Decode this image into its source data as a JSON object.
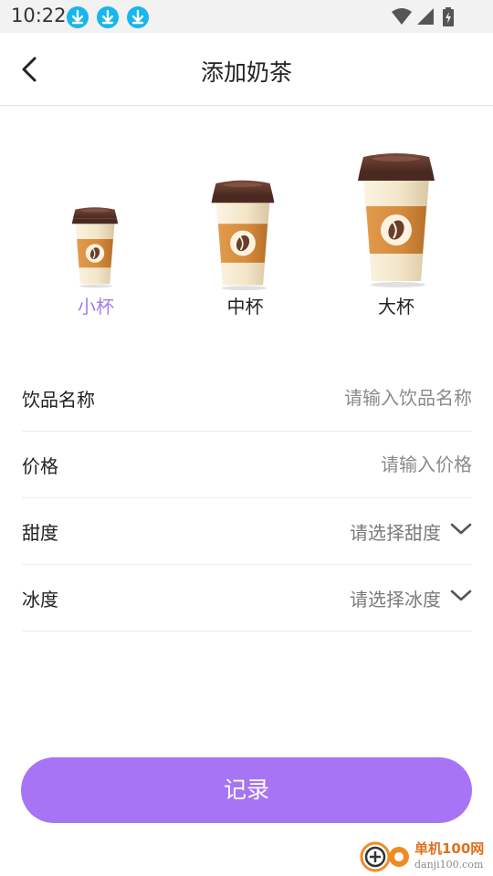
{
  "status_bar": {
    "time": "10:22",
    "notification_icons": [
      "download-icon",
      "download-icon",
      "download-icon"
    ],
    "system_icons": [
      "wifi-icon",
      "signal-icon",
      "battery-charging-icon"
    ]
  },
  "header": {
    "title": "添加奶茶",
    "back_icon": "chevron-left-icon"
  },
  "cup_sizes": {
    "selected": "小杯",
    "options": [
      {
        "label": "小杯",
        "icon": "small-cup-icon"
      },
      {
        "label": "中杯",
        "icon": "medium-cup-icon"
      },
      {
        "label": "大杯",
        "icon": "large-cup-icon"
      }
    ]
  },
  "form": {
    "name": {
      "label": "饮品名称",
      "value": "",
      "placeholder": "请输入饮品名称"
    },
    "price": {
      "label": "价格",
      "value": "",
      "placeholder": "请输入价格"
    },
    "sweetness": {
      "label": "甜度",
      "value": "请选择甜度",
      "icon": "chevron-down-icon"
    },
    "ice": {
      "label": "冰度",
      "value": "请选择冰度",
      "icon": "chevron-down-icon"
    }
  },
  "submit_label": "记录",
  "watermark": {
    "title": "单机100网",
    "url": "danji100.com"
  },
  "colors": {
    "accent": "#a774f6",
    "selected_label": "#a57bf2",
    "status_bar": "#f2f2f2",
    "download_badge": "#16b6ef",
    "cup_lid": "#5a3328",
    "cup_sleeve": "#d88d3e",
    "cup_body": "#f3e8cf"
  }
}
